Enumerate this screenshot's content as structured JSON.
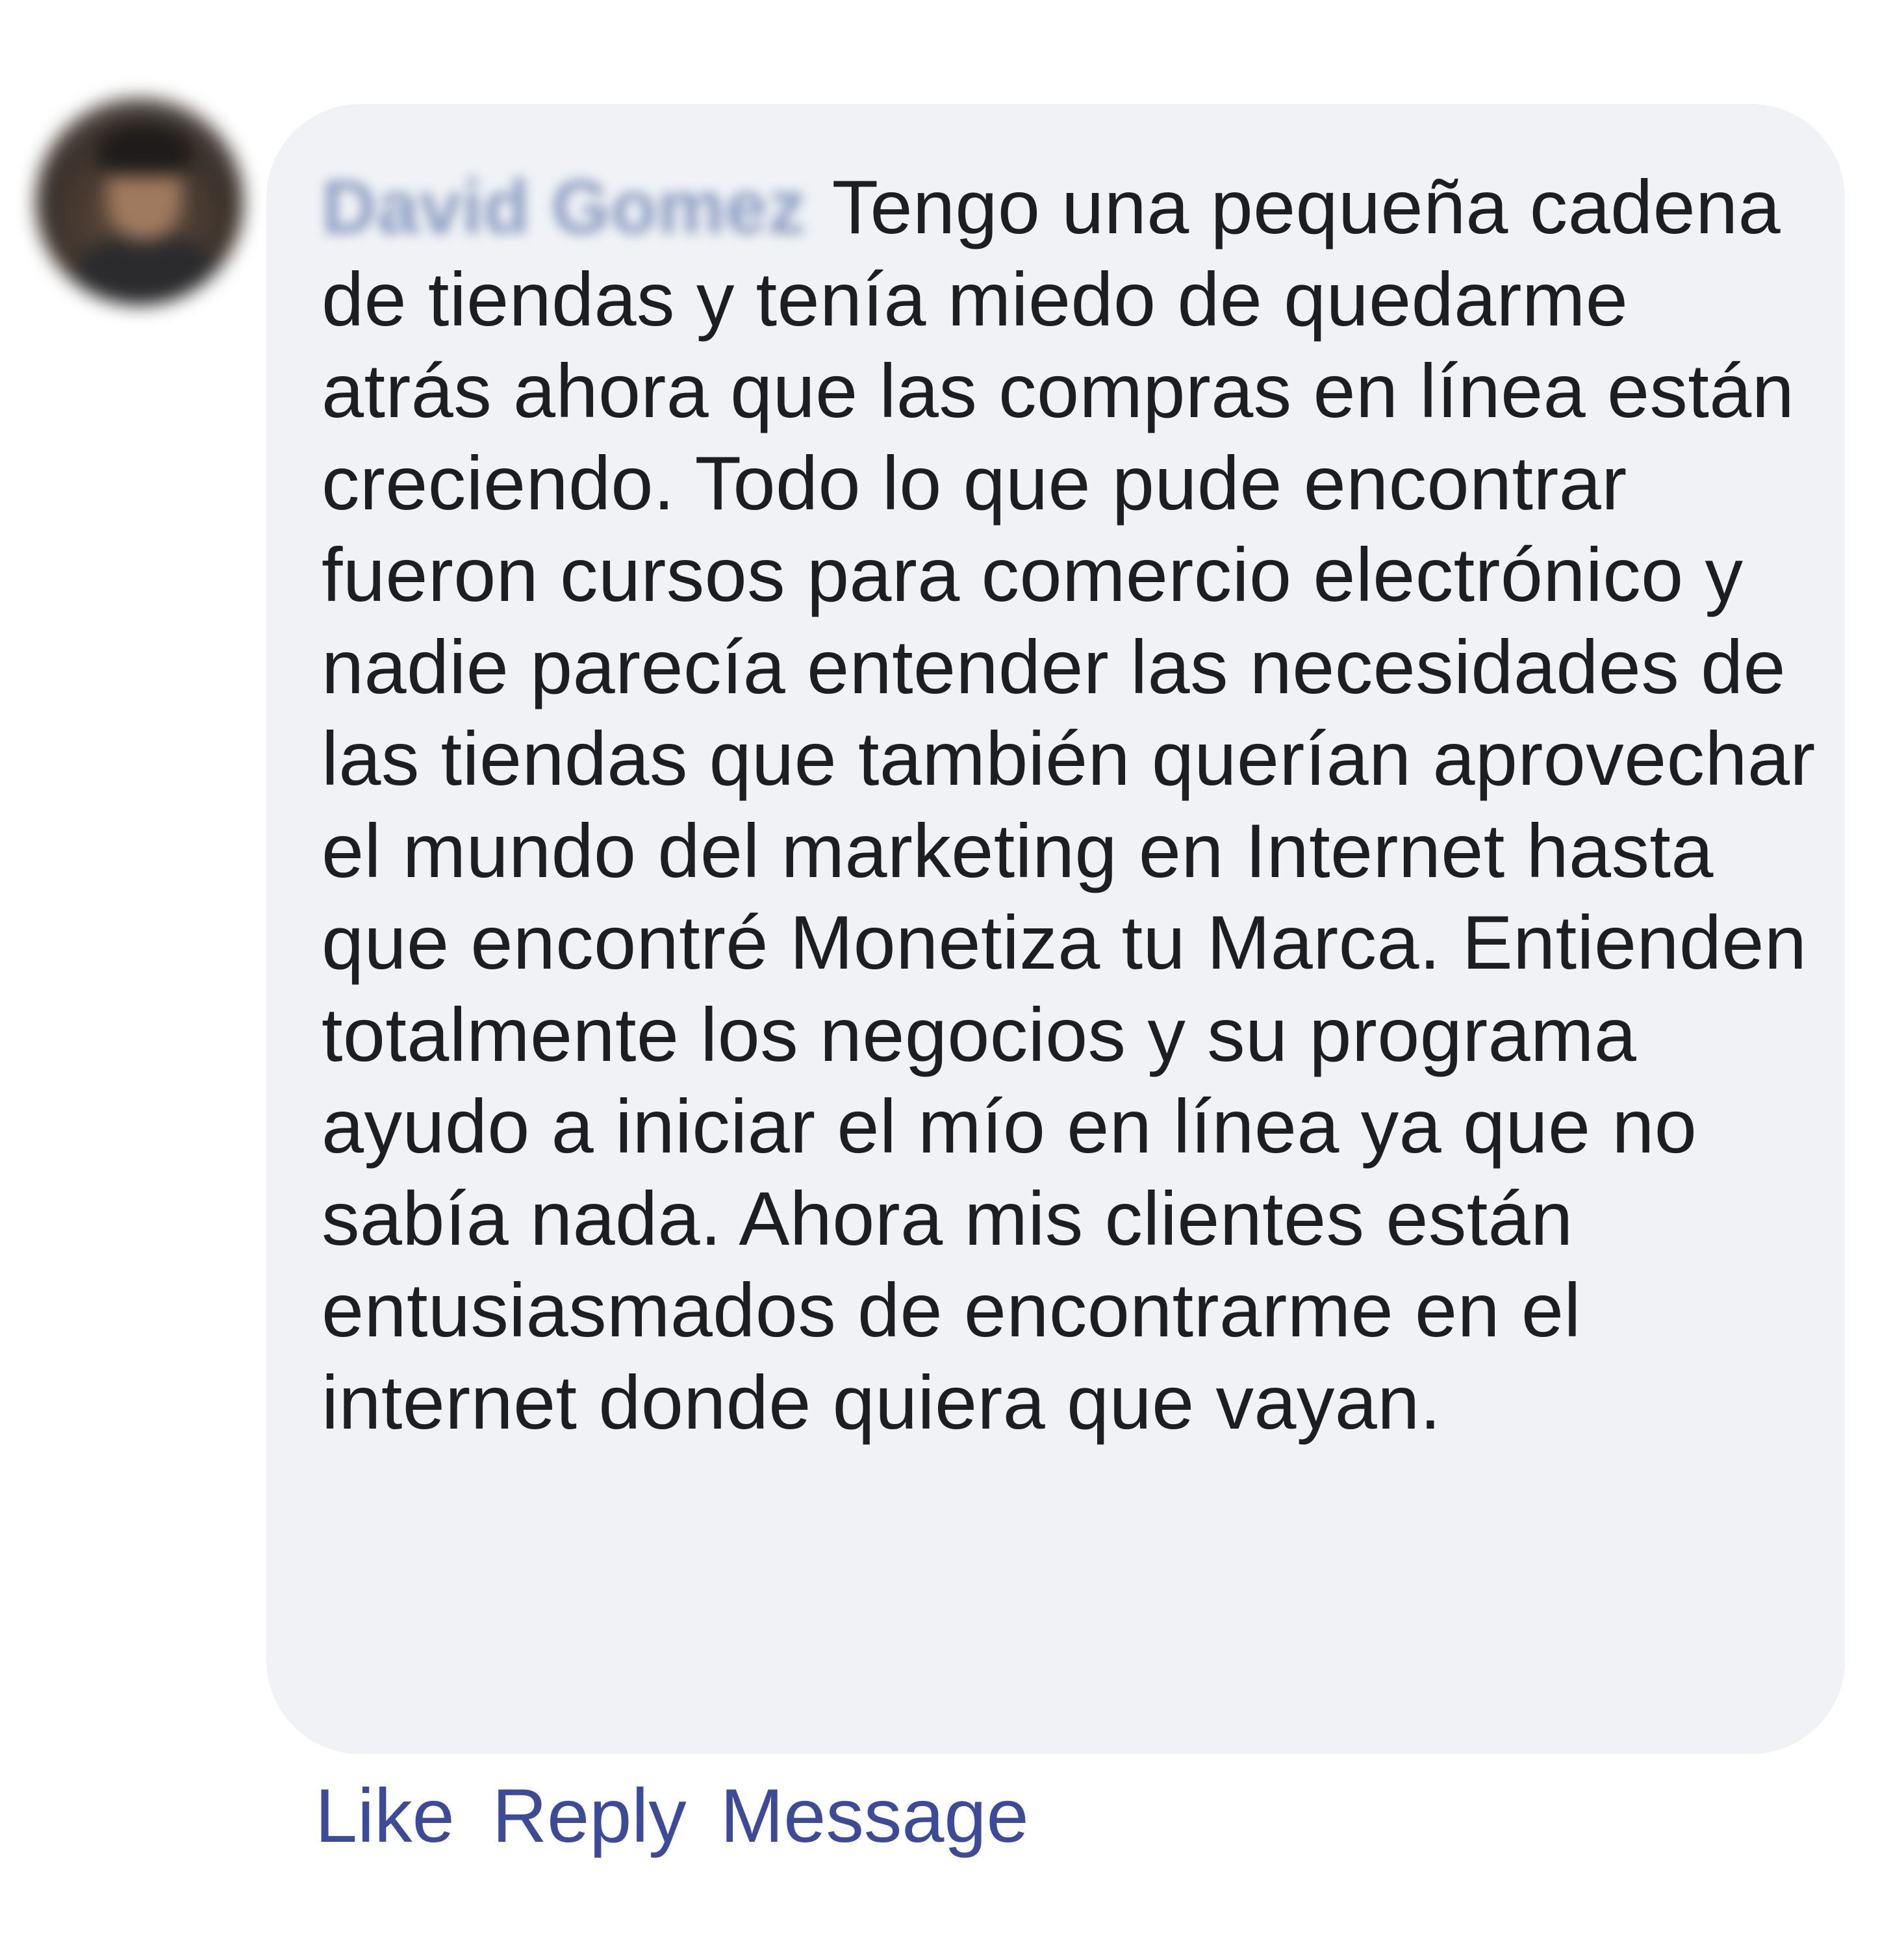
{
  "comment": {
    "author": "David Gomez",
    "text": "Tengo una pequeña cadena de tiendas y tenía miedo de quedarme atrás ahora que las compras en línea están creciendo. Todo lo que pude encontrar fueron cursos para comercio electrónico y nadie parecía entender las necesidades de las tiendas que también querían aprovechar el mundo del marketing en Internet hasta que encontré Monetiza tu Marca. Entienden totalmente los negocios y su programa ayudo a iniciar el mío en línea ya que no sabía nada. Ahora mis clientes están entusiasmados de encontrarme en el internet donde quiera que vayan."
  },
  "actions": {
    "like_label": "Like",
    "reply_label": "Reply",
    "message_label": "Message"
  },
  "colors": {
    "bubble_background": "#f0f2f5",
    "text": "#1c1e21",
    "action_link": "#3b4a9b",
    "author_link": "#385898"
  }
}
